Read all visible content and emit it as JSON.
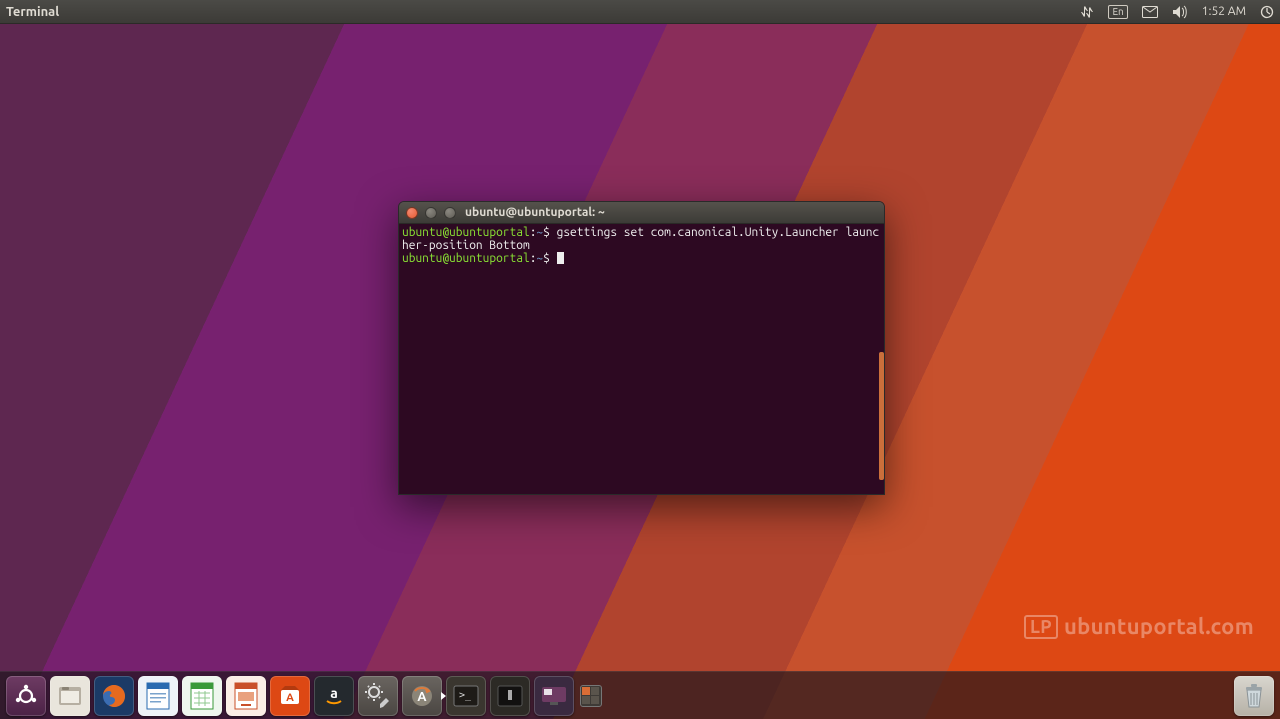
{
  "menubar": {
    "app": "Terminal",
    "clock": "1:52 AM",
    "lang": "En"
  },
  "terminal": {
    "title": "ubuntu@ubuntuportal: ~",
    "prompt_user": "ubuntu@ubuntuportal",
    "prompt_path": "~",
    "command": "gsettings set com.canonical.Unity.Launcher launcher-position Bottom"
  },
  "launcher": {
    "items": [
      {
        "name": "dash",
        "label": "Dash"
      },
      {
        "name": "files",
        "label": "Files"
      },
      {
        "name": "firefox",
        "label": "Firefox"
      },
      {
        "name": "writer",
        "label": "LibreOffice Writer"
      },
      {
        "name": "calc",
        "label": "LibreOffice Calc"
      },
      {
        "name": "impress",
        "label": "LibreOffice Impress"
      },
      {
        "name": "software",
        "label": "Ubuntu Software"
      },
      {
        "name": "amazon",
        "label": "Amazon"
      },
      {
        "name": "settings",
        "label": "System Settings"
      },
      {
        "name": "updater",
        "label": "Software Updater"
      },
      {
        "name": "terminal",
        "label": "Terminal"
      },
      {
        "name": "terminal2",
        "label": "Terminal"
      },
      {
        "name": "screenshot",
        "label": "Desktop"
      }
    ]
  },
  "watermark": {
    "badge": "LP",
    "text": "ubuntuportal.com"
  }
}
